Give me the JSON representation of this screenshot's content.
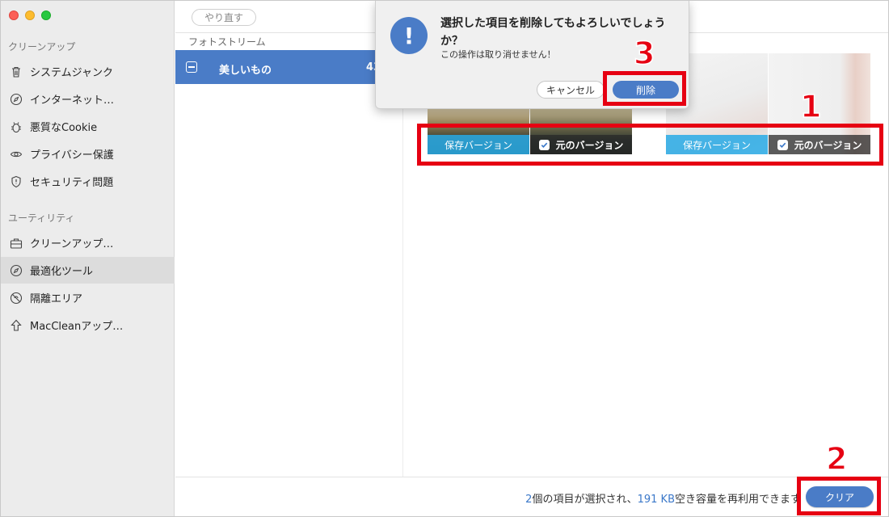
{
  "sidebar": {
    "section1": "クリーンアップ",
    "items1": [
      {
        "label": "システムジャンク",
        "icon": "trash-icon"
      },
      {
        "label": "インターネット…",
        "icon": "compass-icon"
      },
      {
        "label": "悪質なCookie",
        "icon": "bug-icon"
      },
      {
        "label": "プライバシー保護",
        "icon": "eye-icon"
      },
      {
        "label": "セキュリティ問題",
        "icon": "shield-icon"
      }
    ],
    "section2": "ユーティリティ",
    "items2": [
      {
        "label": "クリーンアップ…",
        "icon": "briefcase-icon"
      },
      {
        "label": "最適化ツール",
        "icon": "compass-icon"
      },
      {
        "label": "隔離エリア",
        "icon": "quarantine-icon"
      },
      {
        "label": "MacCleanアップ…",
        "icon": "upload-arrow-icon"
      }
    ]
  },
  "toolbar": {
    "redo_label": "やり直す"
  },
  "list": {
    "header": "フォトストリーム",
    "row_label": "美しいもの",
    "row_count": "43"
  },
  "preview": {
    "save_version": "保存バージョン",
    "original_version": "元のバージョン"
  },
  "bottom": {
    "count": "2",
    "text1": "個の項目が選択され、",
    "size": "191 KB",
    "text2": "空き容量を再利用できます",
    "clear_label": "クリア"
  },
  "dialog": {
    "title": "選択した項目を削除してもよろしいでしょうか？",
    "message": "この操作は取り消せません！",
    "cancel_label": "キャンセル",
    "delete_label": "削除"
  },
  "annotations": {
    "n1": "1",
    "n2": "2",
    "n3": "3"
  },
  "colors": {
    "accent": "#4a7cc7",
    "annotation": "#e60012"
  }
}
